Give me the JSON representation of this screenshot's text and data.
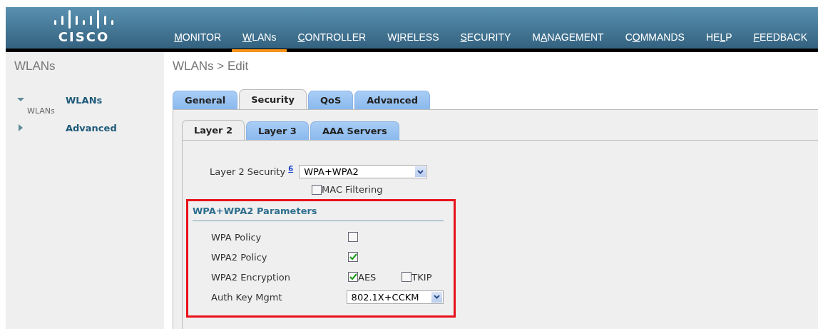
{
  "logo": {
    "text": "CISCO"
  },
  "nav": [
    {
      "key": "M",
      "rest": "ONITOR",
      "selected": false
    },
    {
      "key": "W",
      "rest": "LANs",
      "selected": true
    },
    {
      "key": "C",
      "rest": "ONTROLLER",
      "selected": false
    },
    {
      "pre": "W",
      "key": "I",
      "rest": "RELESS",
      "selected": false
    },
    {
      "key": "S",
      "rest": "ECURITY",
      "selected": false
    },
    {
      "pre": "M",
      "key": "A",
      "rest": "NAGEMENT",
      "selected": false
    },
    {
      "pre": "C",
      "key": "O",
      "rest": "MMANDS",
      "selected": false
    },
    {
      "pre": "HE",
      "key": "L",
      "rest": "P",
      "selected": false
    },
    {
      "key": "F",
      "rest": "EEDBACK",
      "selected": false
    }
  ],
  "sidebar": {
    "title": "WLANs",
    "items": [
      {
        "label": "WLANs",
        "expanded": true,
        "children": [
          {
            "label": "WLANs"
          }
        ]
      },
      {
        "label": "Advanced",
        "expanded": false
      }
    ]
  },
  "page_title": "WLANs > Edit",
  "tabs": [
    {
      "label": "General",
      "selected": false
    },
    {
      "label": "Security",
      "selected": true
    },
    {
      "label": "QoS",
      "selected": false
    },
    {
      "label": "Advanced",
      "selected": false
    }
  ],
  "subtabs": [
    {
      "label": "Layer 2",
      "selected": true
    },
    {
      "label": "Layer 3",
      "selected": false
    },
    {
      "label": "AAA Servers",
      "selected": false
    }
  ],
  "layer2_security": {
    "label": "Layer 2 Security",
    "footnote": "6",
    "value": "WPA+WPA2"
  },
  "mac_filtering": {
    "label": "MAC Filtering",
    "checked": false
  },
  "parameters": {
    "title": "WPA+WPA2 Parameters",
    "highlighted": true,
    "rows": [
      {
        "kind": "checkbox",
        "label": "WPA Policy",
        "checked": false
      },
      {
        "kind": "checkbox",
        "label": "WPA2 Policy",
        "checked": true
      },
      {
        "kind": "checks",
        "label": "WPA2 Encryption",
        "options": [
          {
            "label": "AES",
            "checked": true
          },
          {
            "label": "TKIP",
            "checked": false
          }
        ]
      },
      {
        "kind": "select",
        "label": "Auth Key Mgmt",
        "value": "802.1X+CCKM"
      }
    ]
  }
}
